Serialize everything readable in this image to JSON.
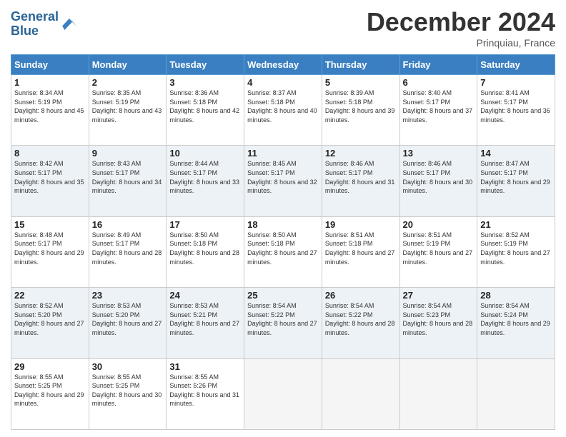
{
  "header": {
    "logo_line1": "General",
    "logo_line2": "Blue",
    "month_title": "December 2024",
    "location": "Prinquiau, France"
  },
  "weekdays": [
    "Sunday",
    "Monday",
    "Tuesday",
    "Wednesday",
    "Thursday",
    "Friday",
    "Saturday"
  ],
  "weeks": [
    [
      {
        "day": "1",
        "sunrise": "8:34 AM",
        "sunset": "5:19 PM",
        "daylight": "8 hours and 45 minutes."
      },
      {
        "day": "2",
        "sunrise": "8:35 AM",
        "sunset": "5:19 PM",
        "daylight": "8 hours and 43 minutes."
      },
      {
        "day": "3",
        "sunrise": "8:36 AM",
        "sunset": "5:18 PM",
        "daylight": "8 hours and 42 minutes."
      },
      {
        "day": "4",
        "sunrise": "8:37 AM",
        "sunset": "5:18 PM",
        "daylight": "8 hours and 40 minutes."
      },
      {
        "day": "5",
        "sunrise": "8:39 AM",
        "sunset": "5:18 PM",
        "daylight": "8 hours and 39 minutes."
      },
      {
        "day": "6",
        "sunrise": "8:40 AM",
        "sunset": "5:17 PM",
        "daylight": "8 hours and 37 minutes."
      },
      {
        "day": "7",
        "sunrise": "8:41 AM",
        "sunset": "5:17 PM",
        "daylight": "8 hours and 36 minutes."
      }
    ],
    [
      {
        "day": "8",
        "sunrise": "8:42 AM",
        "sunset": "5:17 PM",
        "daylight": "8 hours and 35 minutes."
      },
      {
        "day": "9",
        "sunrise": "8:43 AM",
        "sunset": "5:17 PM",
        "daylight": "8 hours and 34 minutes."
      },
      {
        "day": "10",
        "sunrise": "8:44 AM",
        "sunset": "5:17 PM",
        "daylight": "8 hours and 33 minutes."
      },
      {
        "day": "11",
        "sunrise": "8:45 AM",
        "sunset": "5:17 PM",
        "daylight": "8 hours and 32 minutes."
      },
      {
        "day": "12",
        "sunrise": "8:46 AM",
        "sunset": "5:17 PM",
        "daylight": "8 hours and 31 minutes."
      },
      {
        "day": "13",
        "sunrise": "8:46 AM",
        "sunset": "5:17 PM",
        "daylight": "8 hours and 30 minutes."
      },
      {
        "day": "14",
        "sunrise": "8:47 AM",
        "sunset": "5:17 PM",
        "daylight": "8 hours and 29 minutes."
      }
    ],
    [
      {
        "day": "15",
        "sunrise": "8:48 AM",
        "sunset": "5:17 PM",
        "daylight": "8 hours and 29 minutes."
      },
      {
        "day": "16",
        "sunrise": "8:49 AM",
        "sunset": "5:17 PM",
        "daylight": "8 hours and 28 minutes."
      },
      {
        "day": "17",
        "sunrise": "8:50 AM",
        "sunset": "5:18 PM",
        "daylight": "8 hours and 28 minutes."
      },
      {
        "day": "18",
        "sunrise": "8:50 AM",
        "sunset": "5:18 PM",
        "daylight": "8 hours and 27 minutes."
      },
      {
        "day": "19",
        "sunrise": "8:51 AM",
        "sunset": "5:18 PM",
        "daylight": "8 hours and 27 minutes."
      },
      {
        "day": "20",
        "sunrise": "8:51 AM",
        "sunset": "5:19 PM",
        "daylight": "8 hours and 27 minutes."
      },
      {
        "day": "21",
        "sunrise": "8:52 AM",
        "sunset": "5:19 PM",
        "daylight": "8 hours and 27 minutes."
      }
    ],
    [
      {
        "day": "22",
        "sunrise": "8:52 AM",
        "sunset": "5:20 PM",
        "daylight": "8 hours and 27 minutes."
      },
      {
        "day": "23",
        "sunrise": "8:53 AM",
        "sunset": "5:20 PM",
        "daylight": "8 hours and 27 minutes."
      },
      {
        "day": "24",
        "sunrise": "8:53 AM",
        "sunset": "5:21 PM",
        "daylight": "8 hours and 27 minutes."
      },
      {
        "day": "25",
        "sunrise": "8:54 AM",
        "sunset": "5:22 PM",
        "daylight": "8 hours and 27 minutes."
      },
      {
        "day": "26",
        "sunrise": "8:54 AM",
        "sunset": "5:22 PM",
        "daylight": "8 hours and 28 minutes."
      },
      {
        "day": "27",
        "sunrise": "8:54 AM",
        "sunset": "5:23 PM",
        "daylight": "8 hours and 28 minutes."
      },
      {
        "day": "28",
        "sunrise": "8:54 AM",
        "sunset": "5:24 PM",
        "daylight": "8 hours and 29 minutes."
      }
    ],
    [
      {
        "day": "29",
        "sunrise": "8:55 AM",
        "sunset": "5:25 PM",
        "daylight": "8 hours and 29 minutes."
      },
      {
        "day": "30",
        "sunrise": "8:55 AM",
        "sunset": "5:25 PM",
        "daylight": "8 hours and 30 minutes."
      },
      {
        "day": "31",
        "sunrise": "8:55 AM",
        "sunset": "5:26 PM",
        "daylight": "8 hours and 31 minutes."
      },
      null,
      null,
      null,
      null
    ]
  ]
}
